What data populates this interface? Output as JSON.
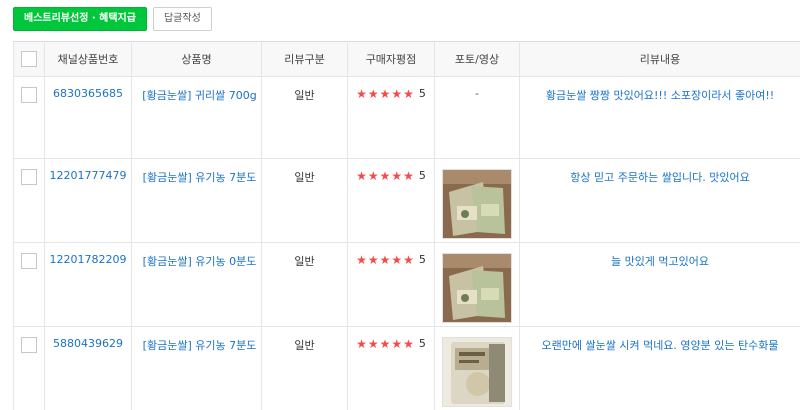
{
  "toolbar": {
    "best_review_label": "베스트리뷰선정 · 혜택지급",
    "reply_label": "답글작성"
  },
  "columns": [
    "채널상품번호",
    "상품명",
    "리뷰구분",
    "구매자평점",
    "포토/영상",
    "리뷰내용"
  ],
  "rows": [
    {
      "product_no": "6830365685",
      "product_name": "[황금눈쌀] 귀리쌀 700g",
      "review_type": "일반",
      "rating": "5",
      "photo": "-",
      "content": "황금눈쌀 짱짱 맛있어요!!! 소포장이라서 좋아여!!"
    },
    {
      "product_no": "12201777479",
      "product_name": "[황금눈쌀] 유기농 7분도",
      "review_type": "일반",
      "rating": "5",
      "photo": "rice-bag-photo",
      "content": "항상 믿고 주문하는 쌀입니다. 맛있어요"
    },
    {
      "product_no": "12201782209",
      "product_name": "[황금눈쌀] 유기농 0분도",
      "review_type": "일반",
      "rating": "5",
      "photo": "rice-bag-photo",
      "content": "늘 맛있게 먹고있어요"
    },
    {
      "product_no": "5880439629",
      "product_name": "[황금눈쌀] 유기농 7분도",
      "review_type": "일반",
      "rating": "5",
      "photo": "rice-package-photo",
      "content": "오랜만에 쌀눈쌀 시켜 먹네요. 영양분 있는 탄수화물"
    }
  ],
  "colors": {
    "accent_green": "#00c63b",
    "link_blue": "#1a73c7",
    "star_red": "#f24b4b"
  }
}
